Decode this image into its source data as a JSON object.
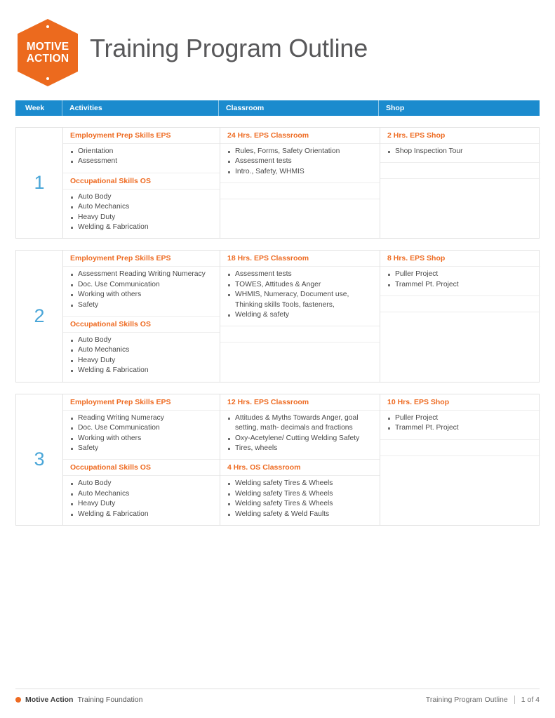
{
  "header": {
    "logo": {
      "line1": "MOTIVE",
      "line2": "ACTION"
    },
    "title": "Training Program Outline"
  },
  "table": {
    "columns": {
      "week": "Week",
      "activities": "Activities",
      "classroom": "Classroom",
      "shop": "Shop"
    },
    "weeks": [
      {
        "number": "1",
        "eps": {
          "activities_title": "Employment Prep Skills EPS",
          "activities_items": [
            "Orientation",
            "Assessment"
          ],
          "classroom_title": "24 Hrs. EPS Classroom",
          "classroom_items": [
            "Rules, Forms, Safety Orientation",
            "Assessment tests",
            "Intro., Safety, WHMIS"
          ],
          "shop_title": "2 Hrs. EPS Shop",
          "shop_items": [
            "Shop Inspection Tour"
          ]
        },
        "os": {
          "activities_title": "Occupational Skills OS",
          "activities_items": [
            "Auto Body",
            "Auto Mechanics",
            "Heavy Duty",
            "Welding & Fabrication"
          ],
          "classroom_title": "",
          "classroom_items": [],
          "shop_title": "",
          "shop_items": []
        }
      },
      {
        "number": "2",
        "eps": {
          "activities_title": "Employment Prep Skills EPS",
          "activities_items": [
            "Assessment Reading Writing Numeracy",
            "Doc. Use Communication",
            "Working with others",
            "Safety"
          ],
          "classroom_title": "18 Hrs. EPS Classroom",
          "classroom_items": [
            "Assessment tests",
            "TOWES, Attitudes & Anger",
            "WHMIS, Numeracy, Document use, Thinking skills Tools, fasteners,",
            "Welding & safety"
          ],
          "shop_title": "8 Hrs. EPS Shop",
          "shop_items": [
            "Puller Project",
            "Trammel Pt. Project"
          ]
        },
        "os": {
          "activities_title": "Occupational Skills OS",
          "activities_items": [
            "Auto Body",
            "Auto Mechanics",
            "Heavy Duty",
            "Welding & Fabrication"
          ],
          "classroom_title": "",
          "classroom_items": [],
          "shop_title": "",
          "shop_items": []
        }
      },
      {
        "number": "3",
        "eps": {
          "activities_title": "Employment Prep Skills EPS",
          "activities_items": [
            "Reading Writing Numeracy",
            "Doc. Use Communication",
            "Working with others",
            "Safety"
          ],
          "classroom_title": "12 Hrs. EPS Classroom",
          "classroom_items": [
            "Attitudes & Myths Towards Anger, goal setting, math- decimals and fractions",
            "Oxy-Acetylene/ Cutting Welding Safety",
            "Tires, wheels"
          ],
          "shop_title": "10 Hrs. EPS Shop",
          "shop_items": [
            "Puller Project",
            "Trammel Pt. Project"
          ]
        },
        "os": {
          "activities_title": "Occupational Skills OS",
          "activities_items": [
            "Auto Body",
            "Auto Mechanics",
            "Heavy Duty",
            "Welding & Fabrication"
          ],
          "classroom_title": "4 Hrs. OS Classroom",
          "classroom_items": [
            "Welding safety Tires & Wheels",
            "Welding safety Tires & Wheels",
            "Welding safety Tires & Wheels",
            "Welding safety & Weld Faults"
          ],
          "shop_title": "",
          "shop_items": []
        }
      }
    ]
  },
  "footer": {
    "brand": "Motive Action",
    "brand_suffix": "Training Foundation",
    "doc_title": "Training Program Outline",
    "page": "1 of 4"
  },
  "colors": {
    "brand_orange": "#ee6b22",
    "header_blue": "#1b8bce",
    "week_blue": "#4aa6d8",
    "title_gray": "#58585a"
  }
}
